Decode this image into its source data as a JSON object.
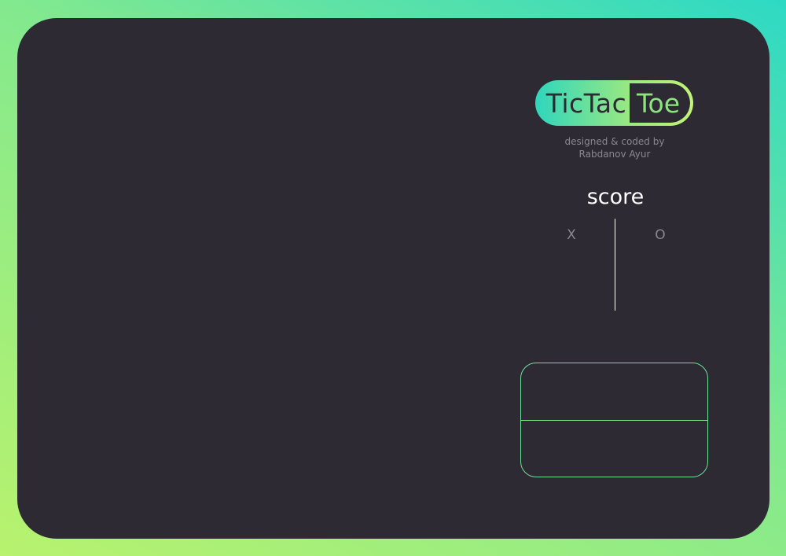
{
  "logo": {
    "part1": "TicTac",
    "part2": "Toe"
  },
  "credit": {
    "line1": "designed & coded by",
    "line2": "Rabdanov Ayur"
  },
  "score": {
    "title": "score",
    "x_label": "X",
    "o_label": "O",
    "x_value": "",
    "o_value": ""
  },
  "buttons": {
    "top_label": "",
    "bottom_label": ""
  },
  "colors": {
    "background_gradient": [
      "#2dd9c5",
      "#83e98e",
      "#b8f26e"
    ],
    "card": "#2d2a33",
    "accent": "#8ce57f",
    "muted_text": "#8a8793"
  }
}
